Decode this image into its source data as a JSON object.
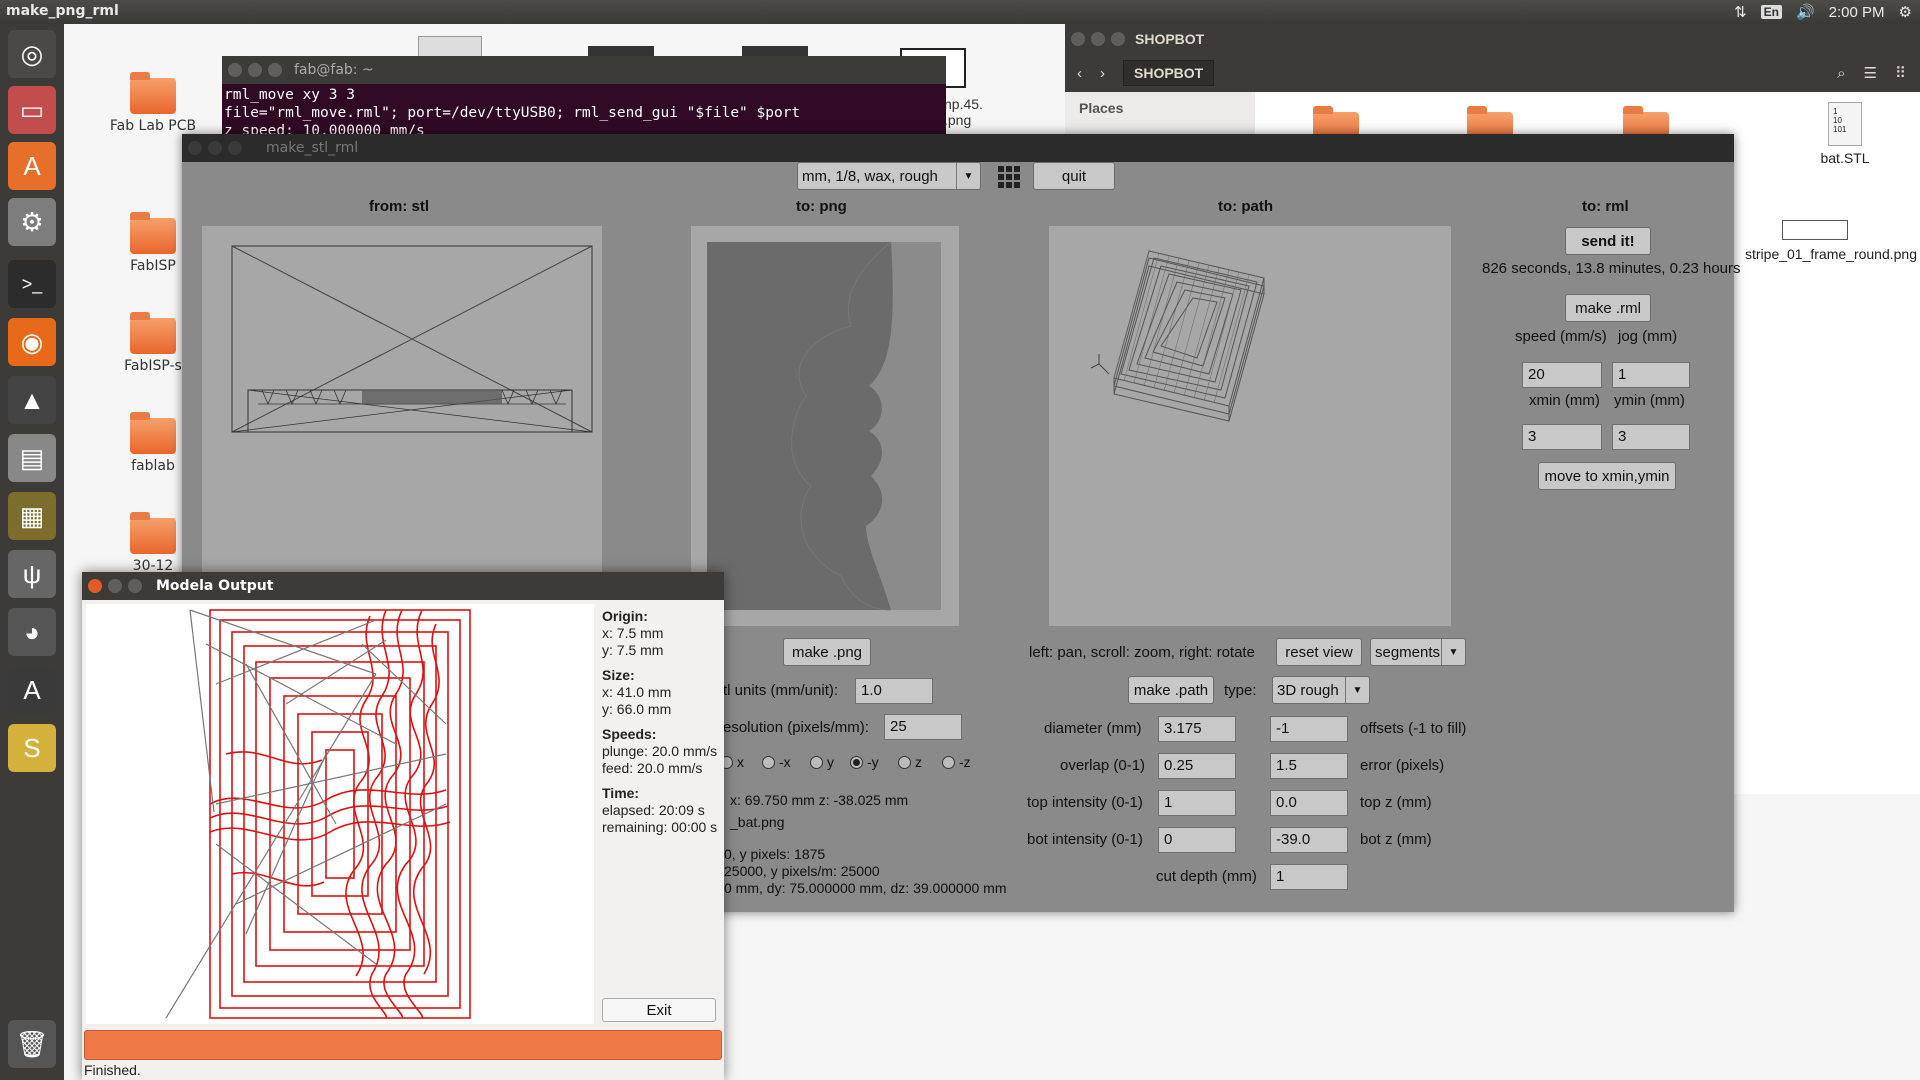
{
  "topbar": {
    "app_name": "make_png_rml",
    "lang": "En",
    "time": "2:00 PM"
  },
  "desktop_icons": [
    {
      "label": "Fab Lab PCB"
    },
    {
      "label": "FabISP"
    },
    {
      "label": "FabISP-s"
    },
    {
      "label": "fablab"
    },
    {
      "label": "30-12"
    }
  ],
  "terminal": {
    "title": "fab@fab: ~",
    "lines": [
      "rml_move xy 3 3",
      "file=\"rml_move.rml\"; port=/dev/ttyUSB0; rml_send_gui \"$file\" $port",
      "z speed: 10.000000 mm/s"
    ]
  },
  "background_file": {
    "label_line1": "np.45.",
    "label_line2": ".png"
  },
  "shopbot": {
    "title": "SHOPBOT",
    "location": "SHOPBOT",
    "places_label": "Places",
    "files": [
      {
        "label": "bat.STL"
      },
      {
        "label": "stripe_01_frame_round.png"
      }
    ]
  },
  "main": {
    "title": "make_stl_rml",
    "preset": "mm, 1/8, wax, rough",
    "quit": "quit",
    "titles": {
      "from_stl": "from: stl",
      "to_png": "to: png",
      "to_path": "to: path",
      "to_rml": "to: rml"
    },
    "rml": {
      "send": "send it!",
      "time_estimate": "826 seconds, 13.8 minutes, 0.23 hours",
      "make_rml": "make .rml",
      "speed_label": "speed (mm/s)",
      "jog_label": "jog (mm)",
      "speed": "20",
      "jog": "1",
      "xmin_label": "xmin (mm)",
      "ymin_label": "ymin (mm)",
      "xmin": "3",
      "ymin": "3",
      "move_btn": "move to xmin,ymin"
    },
    "png": {
      "make_png": "make .png",
      "units_label": "tl units (mm/unit):",
      "units": "1.0",
      "resolution_label": "esolution (pixels/mm):",
      "resolution": "25",
      "radios": [
        "x",
        "-x",
        "y",
        "-y",
        "z",
        "-z"
      ],
      "selected": "-y",
      "coords": "x: 69.750 mm  z: -38.025 mm",
      "file": "_bat.png",
      "pixels": "0, y pixels: 1875",
      "pixels_m": "25000, y pixels/m: 25000",
      "dims": "0 mm, dy: 75.000000 mm, dz: 39.000000 mm"
    },
    "path": {
      "hint": "left: pan, scroll: zoom, right: rotate",
      "reset": "reset view",
      "view_mode": "segments",
      "make_path": "make .path",
      "type_label": "type:",
      "type": "3D rough",
      "diameter_label": "diameter (mm)",
      "diameter": "3.175",
      "offsets": "-1",
      "offsets_label": "offsets (-1 to fill)",
      "overlap_label": "overlap (0-1)",
      "overlap": "0.25",
      "error": "1.5",
      "error_label": "error (pixels)",
      "top_int_label": "top intensity (0-1)",
      "top_int": "1",
      "top_z": "0.0",
      "top_z_label": "top z (mm)",
      "bot_int_label": "bot intensity (0-1)",
      "bot_int": "0",
      "bot_z": "-39.0",
      "bot_z_label": "bot z (mm)",
      "cut_depth_label": "cut depth (mm)",
      "cut_depth": "1"
    }
  },
  "modela": {
    "title": "Modela Output",
    "origin_h": "Origin:",
    "origin_x": "x: 7.5 mm",
    "origin_y": "y: 7.5 mm",
    "size_h": "Size:",
    "size_x": "x: 41.0 mm",
    "size_y": "y: 66.0 mm",
    "speeds_h": "Speeds:",
    "plunge": "plunge: 20.0 mm/s",
    "feed": "feed: 20.0 mm/s",
    "time_h": "Time:",
    "elapsed": "elapsed: 20:09 s",
    "remaining": "remaining: 00:00 s",
    "exit": "Exit",
    "status": "Finished.",
    "progress": 1.0
  }
}
